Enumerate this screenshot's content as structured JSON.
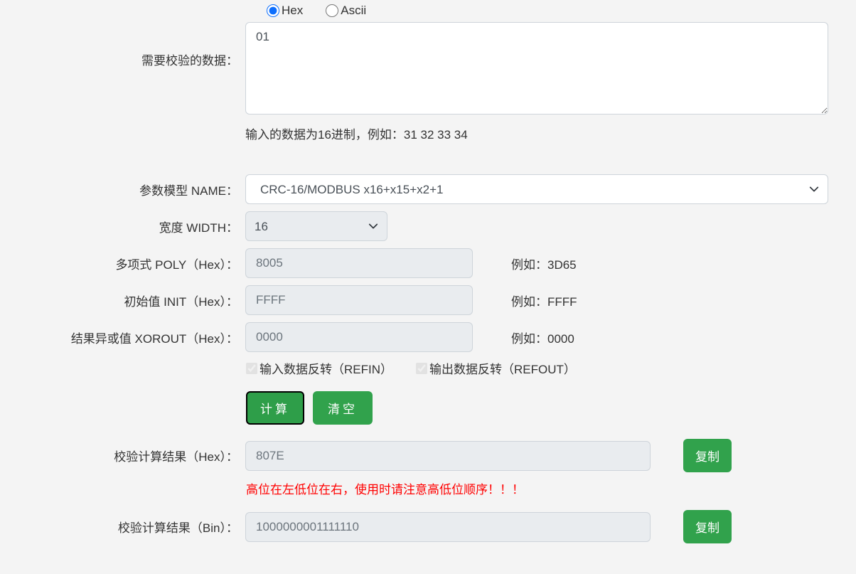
{
  "dataFormat": {
    "hex": {
      "label": "Hex",
      "checked": true
    },
    "ascii": {
      "label": "Ascii",
      "checked": false
    }
  },
  "inputData": {
    "label": "需要校验的数据：",
    "value": "01",
    "hint": "输入的数据为16进制，例如：31 32 33 34"
  },
  "model": {
    "label": "参数模型 NAME：",
    "selected": "CRC-16/MODBUS                x16+x15+x2+1"
  },
  "width": {
    "label": "宽度 WIDTH：",
    "selected": "16"
  },
  "poly": {
    "label": "多项式 POLY（Hex）：",
    "value": "8005",
    "example": "例如：3D65"
  },
  "init": {
    "label": "初始值 INIT（Hex）：",
    "value": "FFFF",
    "example": "例如：FFFF"
  },
  "xorout": {
    "label": "结果异或值 XOROUT（Hex）：",
    "value": "0000",
    "example": "例如：0000"
  },
  "refin": {
    "label": "输入数据反转（REFIN）",
    "checked": true
  },
  "refout": {
    "label": "输出数据反转（REFOUT）",
    "checked": true
  },
  "buttons": {
    "calculate": "计算",
    "clear": "清空",
    "copy": "复制"
  },
  "resultHex": {
    "label": "校验计算结果（Hex）：",
    "value": "807E",
    "warning": "高位在左低位在右，使用时请注意高低位顺序！！！"
  },
  "resultBin": {
    "label": "校验计算结果（Bin）：",
    "value": "1000000001111110"
  }
}
